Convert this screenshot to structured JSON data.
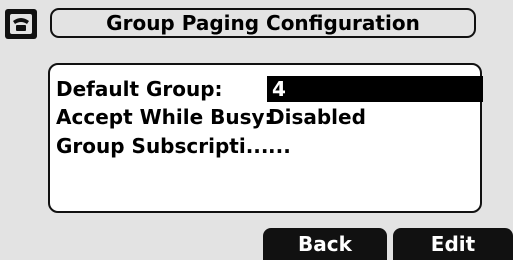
{
  "header": {
    "title": "Group Paging Configuration",
    "icon": "phone-icon"
  },
  "settings": [
    {
      "label": "Default Group:",
      "value": "4",
      "selected": true
    },
    {
      "label": "Accept While Busy:",
      "value": "Disabled",
      "selected": false
    },
    {
      "label": "Group Subscripti...",
      "value": "...",
      "selected": false
    }
  ],
  "softkeys": {
    "back": "Back",
    "edit": "Edit"
  },
  "colors": {
    "background": "#e3e3e3",
    "panel": "#ffffff",
    "highlight": "#000000",
    "softkey": "#111111"
  }
}
